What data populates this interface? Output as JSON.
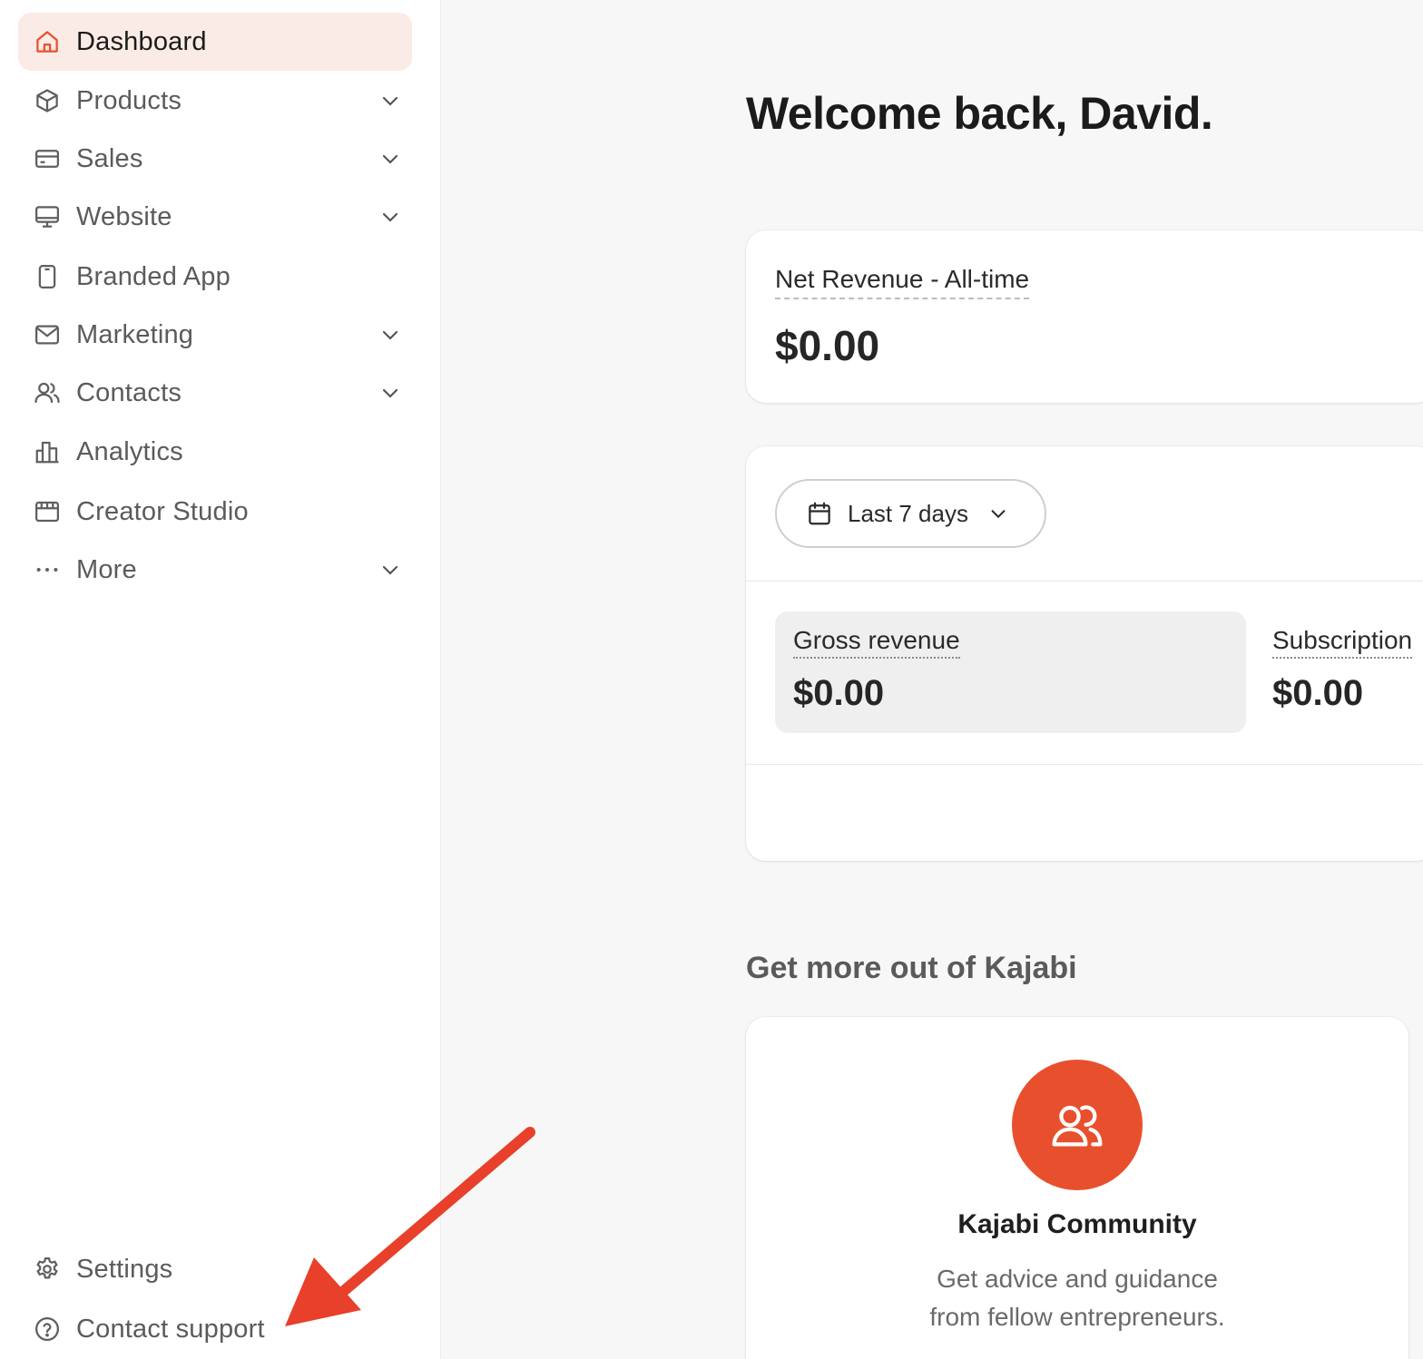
{
  "sidebar": {
    "items": [
      {
        "label": "Dashboard",
        "icon": "home-icon"
      },
      {
        "label": "Products",
        "icon": "box-icon"
      },
      {
        "label": "Sales",
        "icon": "credit-card-icon"
      },
      {
        "label": "Website",
        "icon": "monitor-icon"
      },
      {
        "label": "Branded App",
        "icon": "phone-icon"
      },
      {
        "label": "Marketing",
        "icon": "mail-icon"
      },
      {
        "label": "Contacts",
        "icon": "users-icon"
      },
      {
        "label": "Analytics",
        "icon": "bar-chart-icon"
      },
      {
        "label": "Creator Studio",
        "icon": "calendar-window-icon"
      },
      {
        "label": "More",
        "icon": "more-dots-icon"
      }
    ],
    "footer": [
      {
        "label": "Settings",
        "icon": "gear-icon"
      },
      {
        "label": "Contact support",
        "icon": "help-circle-icon"
      }
    ]
  },
  "main": {
    "welcome": "Welcome back, David.",
    "net_revenue": {
      "title": "Net Revenue - All-time",
      "value": "$0.00"
    },
    "stats": {
      "range_label": "Last 7 days",
      "metrics": [
        {
          "label": "Gross revenue",
          "value": "$0.00"
        },
        {
          "label": "Subscription",
          "value": "$0.00"
        }
      ]
    },
    "section_title": "Get more out of Kajabi",
    "community": {
      "title": "Kajabi Community",
      "description_line1": "Get advice and guidance",
      "description_line2": "from fellow entrepreneurs."
    }
  },
  "colors": {
    "accent": "#e8502d",
    "active_nav_bg": "#fbebe6",
    "annotation_arrow": "#e8402a"
  }
}
